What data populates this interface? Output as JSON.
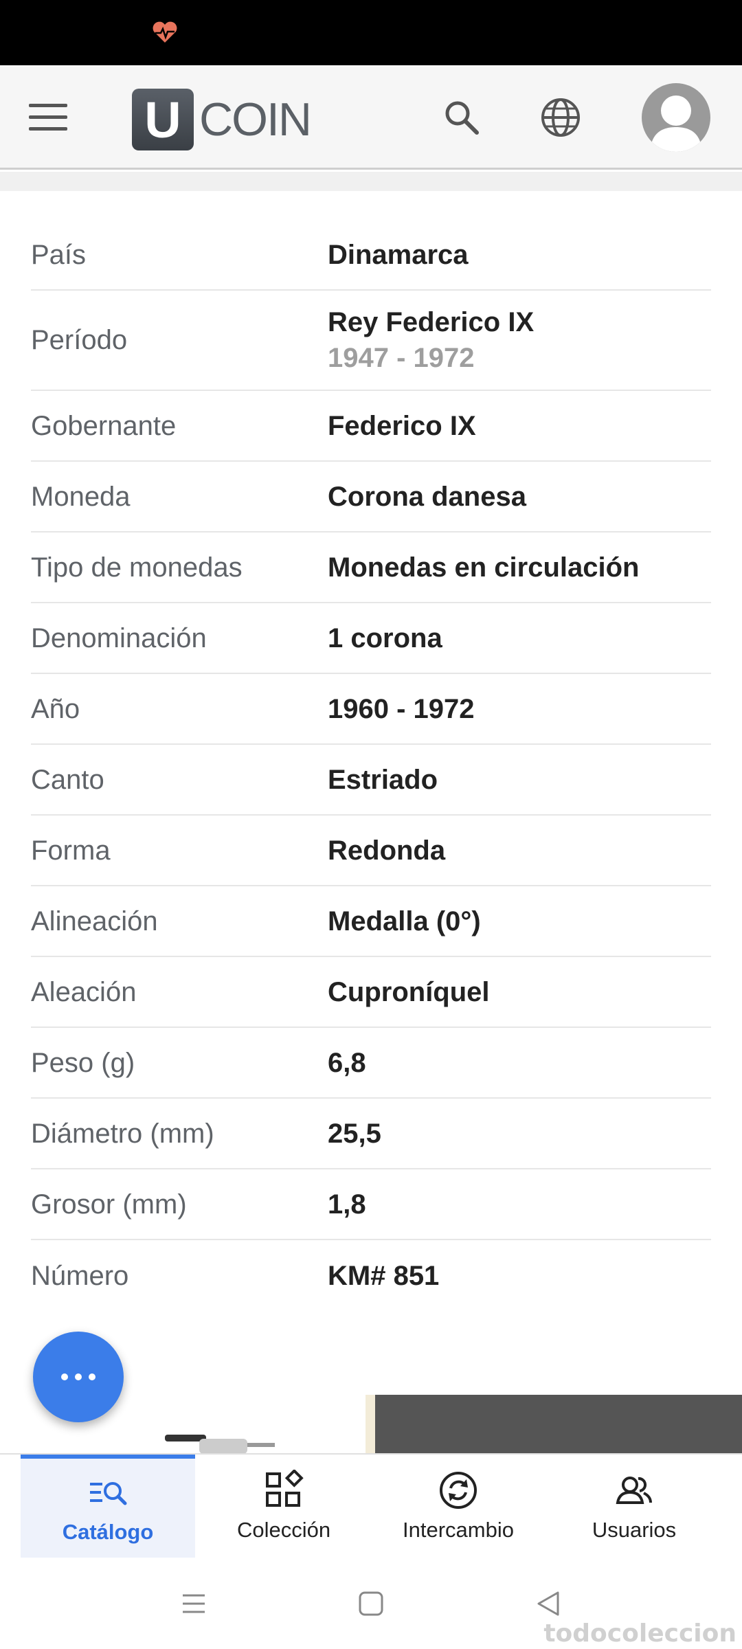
{
  "app": {
    "logo_letter": "U",
    "logo_text": "COIN"
  },
  "details": [
    {
      "key": "País",
      "value": "Dinamarca"
    },
    {
      "key": "Período",
      "value": "Rey Federico IX",
      "sub": "1947 - 1972"
    },
    {
      "key": "Gobernante",
      "value": "Federico IX"
    },
    {
      "key": "Moneda",
      "value": "Corona danesa"
    },
    {
      "key": "Tipo de monedas",
      "value": "Monedas en circulación"
    },
    {
      "key": "Denominación",
      "value": "1 corona"
    },
    {
      "key": "Año",
      "value": "1960 - 1972"
    },
    {
      "key": "Canto",
      "value": "Estriado"
    },
    {
      "key": "Forma",
      "value": "Redonda"
    },
    {
      "key": "Alineación",
      "value": "Medalla (0°)"
    },
    {
      "key": "Aleación",
      "value": "Cuproníquel"
    },
    {
      "key": "Peso (g)",
      "value": "6,8"
    },
    {
      "key": "Diámetro (mm)",
      "value": "25,5"
    },
    {
      "key": "Grosor (mm)",
      "value": "1,8"
    },
    {
      "key": "Número",
      "value": "KM# 851"
    }
  ],
  "bottom_nav": [
    {
      "label": "Catálogo",
      "icon": "catalog-search-icon",
      "active": true
    },
    {
      "label": "Colección",
      "icon": "collection-grid-icon",
      "active": false
    },
    {
      "label": "Intercambio",
      "icon": "exchange-sync-icon",
      "active": false
    },
    {
      "label": "Usuarios",
      "icon": "users-icon",
      "active": false
    }
  ],
  "watermark": "todocoleccion",
  "colors": {
    "accent": "#3b7de9",
    "active_bg": "#eef2fb"
  }
}
